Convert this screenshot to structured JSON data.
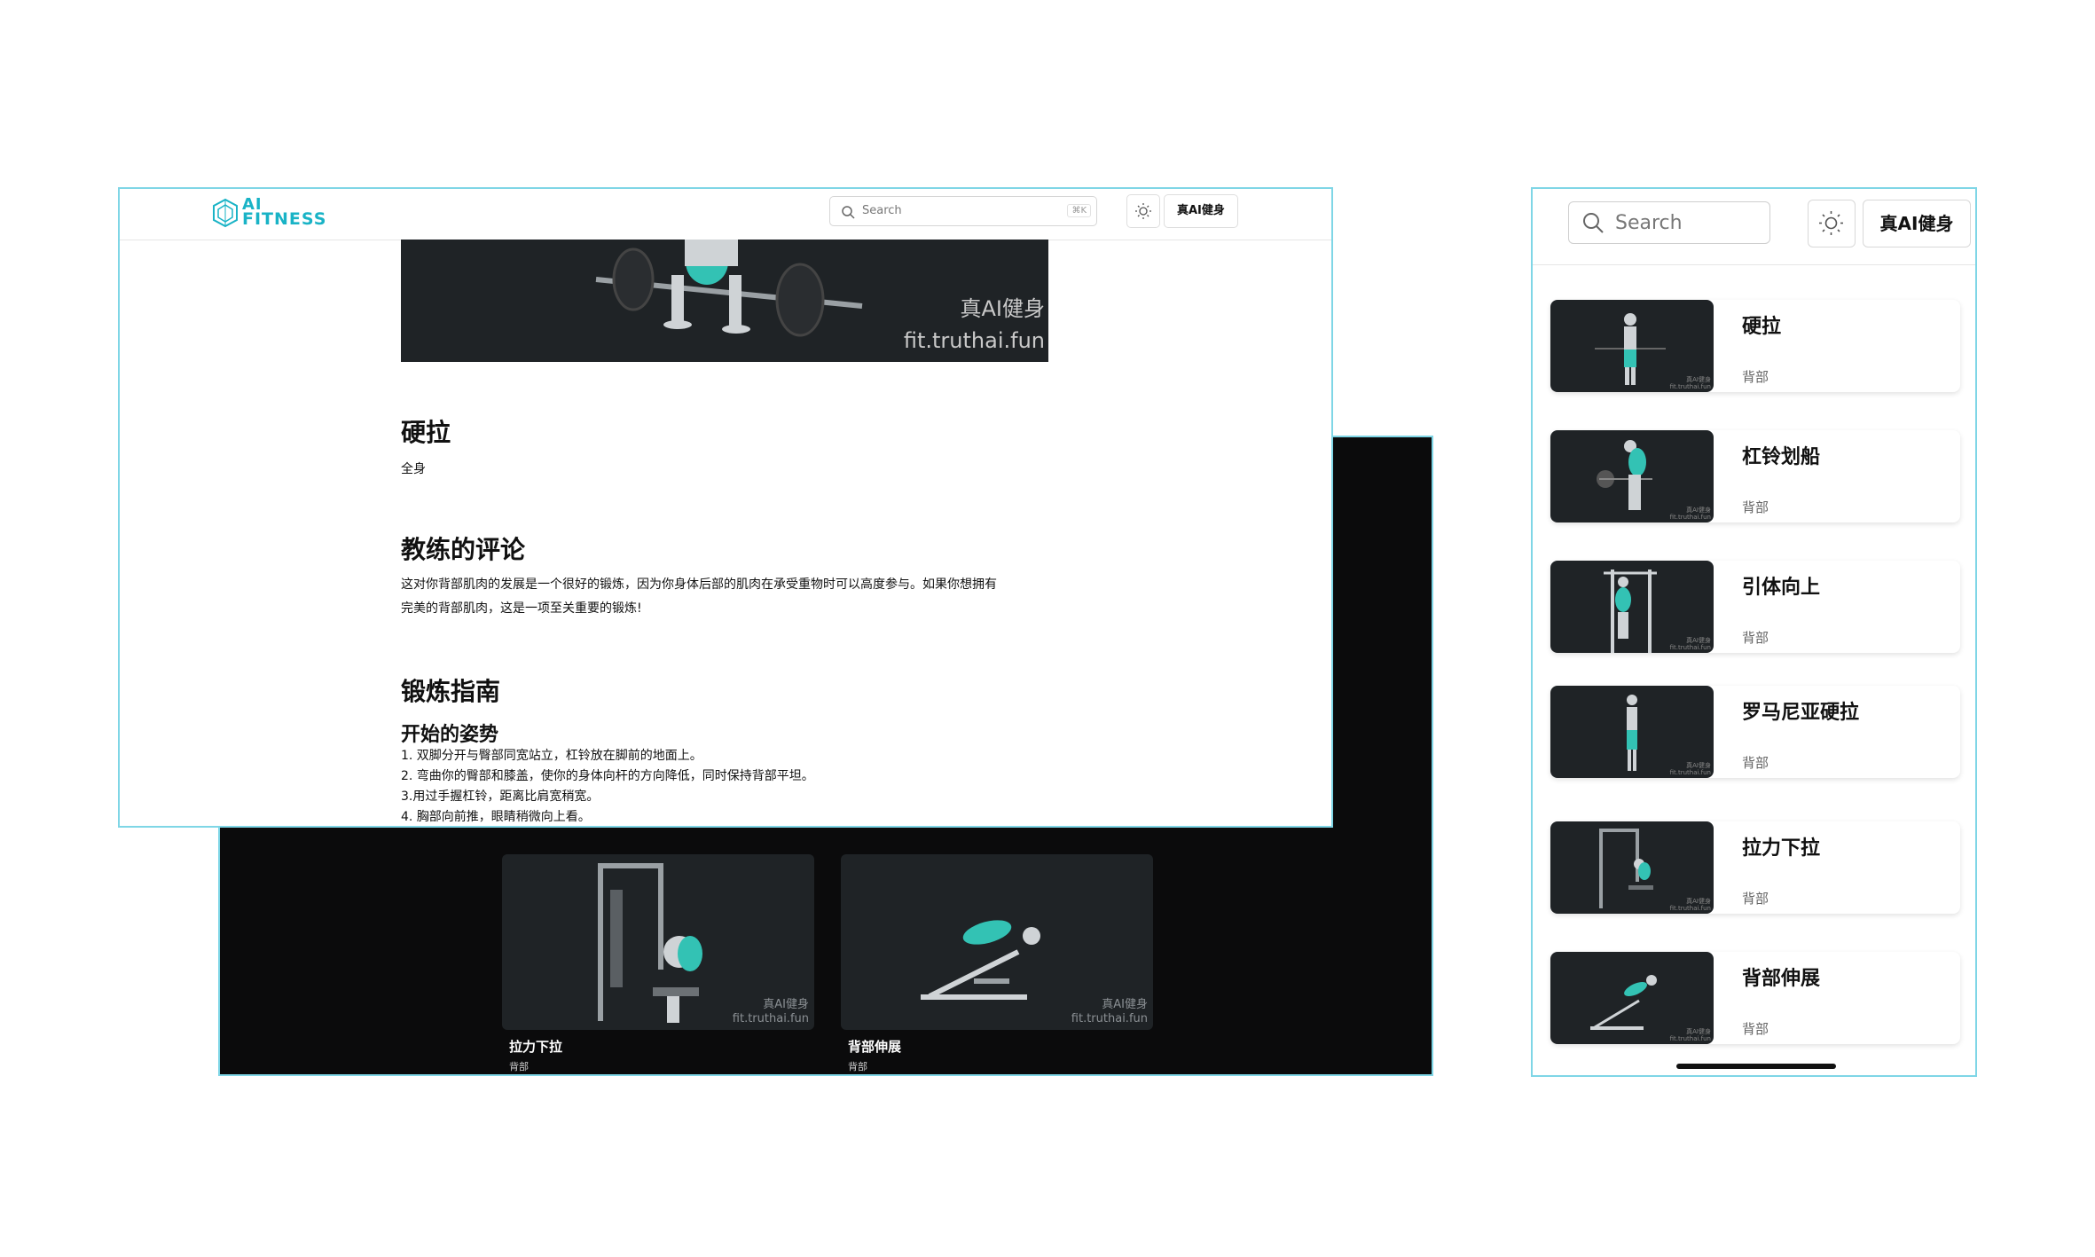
{
  "colors": {
    "accent": "#19b3c6",
    "frame": "#7fd6e6",
    "dark_bg": "#0b0b0c",
    "thumb_bg": "#1f2326"
  },
  "header": {
    "logo_line1": "AI",
    "logo_line2": "FITNESS",
    "search_placeholder": "Search",
    "search_shortcut": "⌘K",
    "theme_icon": "sun-icon",
    "brand_button": "真AI健身"
  },
  "hero": {
    "watermark_line1": "真AI健身",
    "watermark_line2": "fit.truthai.fun"
  },
  "exercise": {
    "title": "硬拉",
    "category": "全身",
    "coach_heading": "教练的评论",
    "coach_comment_line1": "这对你背部肌肉的发展是一个很好的锻炼，因为你身体后部的肌肉在承受重物时可以高度参与。如果你想拥有",
    "coach_comment_line2": "完美的背部肌肉，这是一项至关重要的锻炼!",
    "guide_heading": "锻炼指南",
    "start_heading": "开始的姿势",
    "steps": [
      "1. 双脚分开与臀部同宽站立，杠铃放在脚前的地面上。",
      "2. 弯曲你的臀部和膝盖，使你的身体向杆的方向降低，同时保持背部平坦。",
      "3.用过手握杠铃，距离比肩宽稍宽。",
      "4. 胸部向前推，眼睛稍微向上看。"
    ]
  },
  "related": [
    {
      "title": "拉力下拉",
      "category": "背部",
      "wm1": "真AI健身",
      "wm2": "fit.truthai.fun"
    },
    {
      "title": "背部伸展",
      "category": "背部",
      "wm1": "真AI健身",
      "wm2": "fit.truthai.fun"
    }
  ],
  "mobile": {
    "search_placeholder": "Search",
    "theme_icon": "sun-icon",
    "brand_button": "真AI健身",
    "items": [
      {
        "title": "硬拉",
        "category": "背部"
      },
      {
        "title": "杠铃划船",
        "category": "背部"
      },
      {
        "title": "引体向上",
        "category": "背部"
      },
      {
        "title": "罗马尼亚硬拉",
        "category": "背部"
      },
      {
        "title": "拉力下拉",
        "category": "背部"
      },
      {
        "title": "背部伸展",
        "category": "背部"
      }
    ]
  }
}
